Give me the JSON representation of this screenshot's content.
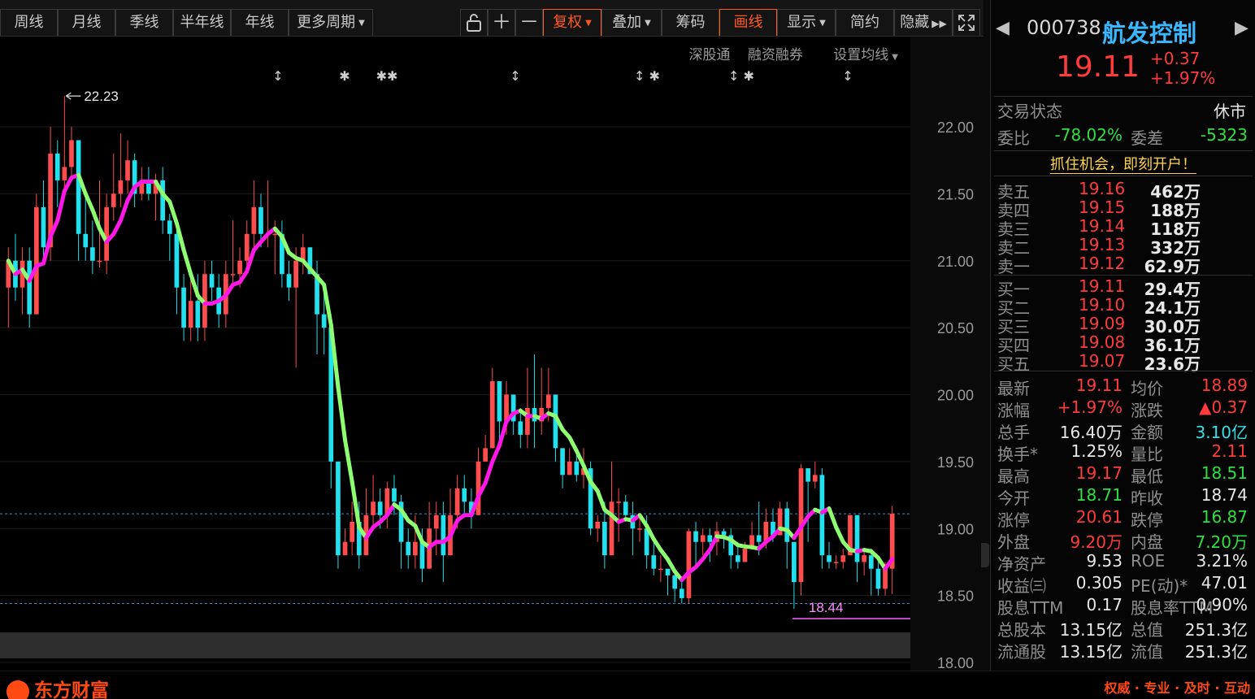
{
  "toolbar": {
    "periods": [
      "周线",
      "月线",
      "季线",
      "半年线",
      "年线"
    ],
    "more_periods": "更多周期",
    "fuquan": "复权",
    "diejia": "叠加",
    "chouma": "筹码",
    "huaxian": "画线",
    "xianshi": "显示",
    "jianyue": "简约",
    "yincang": "隐藏"
  },
  "chart_links": [
    "深股通",
    "融资融券",
    "设置均线"
  ],
  "chart_data": {
    "type": "candlestick",
    "price_axis": {
      "min": 18.0,
      "max": 22.0,
      "tick_labels": [
        "22.00",
        "21.50",
        "21.00",
        "20.50",
        "20.00",
        "19.50",
        "19.00",
        "18.50",
        "18.00"
      ]
    },
    "high_label": "22.23",
    "low_label": "18.44",
    "current_price_line": 19.11,
    "candles": [
      [
        20.8,
        21.0,
        21.1,
        20.5
      ],
      [
        21.0,
        20.8,
        21.2,
        20.7
      ],
      [
        20.8,
        21.0,
        21.1,
        20.6
      ],
      [
        21.0,
        20.6,
        21.1,
        20.5
      ],
      [
        20.6,
        21.4,
        21.5,
        20.6
      ],
      [
        21.4,
        21.1,
        21.6,
        21.0
      ],
      [
        21.1,
        21.8,
        22.0,
        21.0
      ],
      [
        21.8,
        21.6,
        21.9,
        21.4
      ],
      [
        21.6,
        21.7,
        22.23,
        21.5
      ],
      [
        21.7,
        21.9,
        22.0,
        21.6
      ],
      [
        21.9,
        21.2,
        21.9,
        21.0
      ],
      [
        21.2,
        21.1,
        21.5,
        21.0
      ],
      [
        21.1,
        21.0,
        21.3,
        20.9
      ],
      [
        21.0,
        21.0,
        21.6,
        20.95
      ],
      [
        21.0,
        21.4,
        21.5,
        20.9
      ],
      [
        21.4,
        21.5,
        21.8,
        21.3
      ],
      [
        21.5,
        21.6,
        21.95,
        21.4
      ],
      [
        21.6,
        21.75,
        21.9,
        21.5
      ],
      [
        21.75,
        21.5,
        21.8,
        21.4
      ],
      [
        21.5,
        21.6,
        21.7,
        21.45
      ],
      [
        21.6,
        21.5,
        21.7,
        21.45
      ],
      [
        21.5,
        21.6,
        21.65,
        21.3
      ],
      [
        21.6,
        21.3,
        21.7,
        21.2
      ],
      [
        21.3,
        21.2,
        21.35,
        21.0
      ],
      [
        21.2,
        20.8,
        21.3,
        20.6
      ],
      [
        20.8,
        20.5,
        20.9,
        20.4
      ],
      [
        20.5,
        20.7,
        20.9,
        20.4
      ],
      [
        20.7,
        20.5,
        20.9,
        20.4
      ],
      [
        20.5,
        20.9,
        21.0,
        20.4
      ],
      [
        20.9,
        20.8,
        21.0,
        20.7
      ],
      [
        20.8,
        20.6,
        20.9,
        20.5
      ],
      [
        20.6,
        20.9,
        21.0,
        20.5
      ],
      [
        20.9,
        20.9,
        21.3,
        20.8
      ],
      [
        20.9,
        21.0,
        21.1,
        20.8
      ],
      [
        21.0,
        21.2,
        21.3,
        20.9
      ],
      [
        21.2,
        21.4,
        21.6,
        21.1
      ],
      [
        21.4,
        21.2,
        21.5,
        21.1
      ],
      [
        21.2,
        21.2,
        21.6,
        21.1
      ],
      [
        21.2,
        21.2,
        21.3,
        20.9
      ],
      [
        21.2,
        20.9,
        21.3,
        20.8
      ],
      [
        20.9,
        20.8,
        21.0,
        20.7
      ],
      [
        20.8,
        21.0,
        21.1,
        20.2
      ],
      [
        21.0,
        21.1,
        21.2,
        20.9
      ],
      [
        21.1,
        20.9,
        21.1,
        20.9
      ],
      [
        20.9,
        20.6,
        21.0,
        20.3
      ],
      [
        20.6,
        20.5,
        20.8,
        20.3
      ],
      [
        20.5,
        19.5,
        20.6,
        19.3
      ],
      [
        19.5,
        18.8,
        19.5,
        18.7
      ],
      [
        18.8,
        18.9,
        19.0,
        18.8
      ],
      [
        18.9,
        19.05,
        19.2,
        18.8
      ],
      [
        19.05,
        18.8,
        19.2,
        18.7
      ],
      [
        18.8,
        19.1,
        19.3,
        18.8
      ],
      [
        19.1,
        19.2,
        19.4,
        19.0
      ],
      [
        19.2,
        19.1,
        19.3,
        19.0
      ],
      [
        19.1,
        19.3,
        19.35,
        19.0
      ],
      [
        19.3,
        19.2,
        19.4,
        19.1
      ],
      [
        19.2,
        18.9,
        19.25,
        18.7
      ],
      [
        18.9,
        18.8,
        19.0,
        18.7
      ],
      [
        18.8,
        18.9,
        19.1,
        18.7
      ],
      [
        18.9,
        18.7,
        19.0,
        18.6
      ],
      [
        18.7,
        19.0,
        19.2,
        18.7
      ],
      [
        19.0,
        19.1,
        19.2,
        18.8
      ],
      [
        19.1,
        18.8,
        19.2,
        18.6
      ],
      [
        18.8,
        19.1,
        19.3,
        18.8
      ],
      [
        19.1,
        19.3,
        19.4,
        19.0
      ],
      [
        19.3,
        19.2,
        19.4,
        19.1
      ],
      [
        19.2,
        19.1,
        19.3,
        19.0
      ],
      [
        19.1,
        19.5,
        19.6,
        19.1
      ],
      [
        19.5,
        19.6,
        19.7,
        19.5
      ],
      [
        19.6,
        20.1,
        20.2,
        19.6
      ],
      [
        20.1,
        19.8,
        20.1,
        19.6
      ],
      [
        19.8,
        20.0,
        20.1,
        19.7
      ],
      [
        20.0,
        19.8,
        20.0,
        19.7
      ],
      [
        19.8,
        19.7,
        19.9,
        19.6
      ],
      [
        19.7,
        19.9,
        20.2,
        19.6
      ],
      [
        19.9,
        19.8,
        20.3,
        19.6
      ],
      [
        19.8,
        19.9,
        20.2,
        19.7
      ],
      [
        19.9,
        20.0,
        20.2,
        19.8
      ],
      [
        20.0,
        19.6,
        20.0,
        19.5
      ],
      [
        19.6,
        19.4,
        19.6,
        19.3
      ],
      [
        19.4,
        19.5,
        19.6,
        19.4
      ],
      [
        19.5,
        19.4,
        19.55,
        19.35
      ],
      [
        19.4,
        19.45,
        19.6,
        19.3
      ],
      [
        19.45,
        19.0,
        19.5,
        18.95
      ],
      [
        19.0,
        19.05,
        19.1,
        18.9
      ],
      [
        19.05,
        18.8,
        19.2,
        18.7
      ],
      [
        18.8,
        19.2,
        19.5,
        18.8
      ],
      [
        19.2,
        19.2,
        19.3,
        18.9
      ],
      [
        19.2,
        19.1,
        19.25,
        19.05
      ],
      [
        19.1,
        19.0,
        19.2,
        18.8
      ],
      [
        19.0,
        19.0,
        19.1,
        18.9
      ],
      [
        19.0,
        18.8,
        19.1,
        18.7
      ],
      [
        18.8,
        18.7,
        18.9,
        18.65
      ],
      [
        18.7,
        18.7,
        18.8,
        18.6
      ],
      [
        18.7,
        18.65,
        18.7,
        18.5
      ],
      [
        18.65,
        18.55,
        18.7,
        18.45
      ],
      [
        18.55,
        18.48,
        18.6,
        18.44
      ],
      [
        18.48,
        18.98,
        19.0,
        18.44
      ],
      [
        18.98,
        18.9,
        19.05,
        18.7
      ],
      [
        18.9,
        18.95,
        19.0,
        18.8
      ],
      [
        18.95,
        18.9,
        19.0,
        18.75
      ],
      [
        18.9,
        18.98,
        19.05,
        18.8
      ],
      [
        18.98,
        18.95,
        19.0,
        18.85
      ],
      [
        18.95,
        18.8,
        19.0,
        18.7
      ],
      [
        18.8,
        18.75,
        18.9,
        18.7
      ],
      [
        18.75,
        18.85,
        18.9,
        18.75
      ],
      [
        18.85,
        18.95,
        19.05,
        18.85
      ],
      [
        18.95,
        18.9,
        19.2,
        18.8
      ],
      [
        18.9,
        19.05,
        19.15,
        18.85
      ],
      [
        19.05,
        18.95,
        19.15,
        18.9
      ],
      [
        18.95,
        19.15,
        19.2,
        18.95
      ],
      [
        19.15,
        18.9,
        19.2,
        18.7
      ],
      [
        18.9,
        18.6,
        18.9,
        18.4
      ],
      [
        18.6,
        19.45,
        19.48,
        18.5
      ],
      [
        19.45,
        19.35,
        19.45,
        18.9
      ],
      [
        19.35,
        19.4,
        19.5,
        19.3
      ],
      [
        19.4,
        18.8,
        19.45,
        18.7
      ],
      [
        18.8,
        18.75,
        18.9,
        18.7
      ],
      [
        18.75,
        18.75,
        18.8,
        18.7
      ],
      [
        18.75,
        18.8,
        18.85,
        18.7
      ],
      [
        18.8,
        19.1,
        19.1,
        18.8
      ],
      [
        19.1,
        18.75,
        19.1,
        18.6
      ],
      [
        18.75,
        18.8,
        18.85,
        18.65
      ],
      [
        18.8,
        18.7,
        18.85,
        18.5
      ],
      [
        18.7,
        18.55,
        18.75,
        18.5
      ],
      [
        18.55,
        18.7,
        18.75,
        18.5
      ],
      [
        18.7,
        19.11,
        19.17,
        18.51
      ]
    ],
    "ma_color_rising": "#ff18e6",
    "ma_color_falling": "#8dff70",
    "up_color": "#ff4d4d",
    "down_color": "#22e0ee",
    "marks": [
      "↕",
      "✱",
      "✱✱",
      "↕",
      "↕ ✱",
      "↕ ✱",
      "↕"
    ]
  },
  "panel": {
    "code": "000738",
    "name": "航发控制",
    "price": "19.11",
    "change": "+0.37",
    "change_pct": "+1.97%",
    "status_label": "交易状态",
    "status_value": "休市",
    "weibi_label": "委比",
    "weibi_value": "-78.02%",
    "weicha_label": "委差",
    "weicha_value": "-5323",
    "promo": "抓住机会，即刻开户！",
    "asks": [
      {
        "label": "卖五",
        "price": "19.16",
        "vol": "462万"
      },
      {
        "label": "卖四",
        "price": "19.15",
        "vol": "188万"
      },
      {
        "label": "卖三",
        "price": "19.14",
        "vol": "118万"
      },
      {
        "label": "卖二",
        "price": "19.13",
        "vol": "332万"
      },
      {
        "label": "卖一",
        "price": "19.12",
        "vol": "62.9万"
      }
    ],
    "bids": [
      {
        "label": "买一",
        "price": "19.11",
        "vol": "29.4万"
      },
      {
        "label": "买二",
        "price": "19.10",
        "vol": "24.1万"
      },
      {
        "label": "买三",
        "price": "19.09",
        "vol": "30.0万"
      },
      {
        "label": "买四",
        "price": "19.08",
        "vol": "36.1万"
      },
      {
        "label": "买五",
        "price": "19.07",
        "vol": "23.6万"
      }
    ],
    "stats": [
      {
        "l1": "最新",
        "v1": "19.11",
        "c1": "red",
        "l2": "均价",
        "v2": "18.89",
        "c2": "red"
      },
      {
        "l1": "涨幅",
        "v1": "+1.97%",
        "c1": "red",
        "l2": "涨跌",
        "v2": "▲0.37",
        "c2": "red"
      },
      {
        "l1": "总手",
        "v1": "16.40万",
        "c1": "white",
        "l2": "金额",
        "v2": "3.10亿",
        "c2": "cyan"
      },
      {
        "l1": "换手*",
        "v1": "1.25%",
        "c1": "white",
        "l2": "量比",
        "v2": "2.11",
        "c2": "red"
      },
      {
        "l1": "最高",
        "v1": "19.17",
        "c1": "red",
        "l2": "最低",
        "v2": "18.51",
        "c2": "green"
      },
      {
        "l1": "今开",
        "v1": "18.71",
        "c1": "green",
        "l2": "昨收",
        "v2": "18.74",
        "c2": "white"
      },
      {
        "l1": "涨停",
        "v1": "20.61",
        "c1": "red",
        "l2": "跌停",
        "v2": "16.87",
        "c2": "green"
      },
      {
        "l1": "外盘",
        "v1": "9.20万",
        "c1": "red",
        "l2": "内盘",
        "v2": "7.20万",
        "c2": "green"
      },
      {
        "l1": "净资产",
        "v1": "9.53",
        "c1": "white",
        "l2": "ROE",
        "v2": "3.21%",
        "c2": "white"
      },
      {
        "l1": "收益㈢",
        "v1": "0.305",
        "c1": "white",
        "l2": "PE(动)*",
        "v2": "47.01",
        "c2": "white"
      },
      {
        "l1": "股息TTM",
        "v1": "0.17",
        "c1": "white",
        "l2": "股息率TTM",
        "v2": "0.90%",
        "c2": "white"
      },
      {
        "l1": "总股本",
        "v1": "13.15亿",
        "c1": "white",
        "l2": "总值",
        "v2": "251.3亿",
        "c2": "white"
      },
      {
        "l1": "流通股",
        "v1": "13.15亿",
        "c1": "white",
        "l2": "流值",
        "v2": "251.3亿",
        "c2": "white"
      }
    ]
  },
  "footer": {
    "logo": "东方财富",
    "slogan": "权威 · 专业 · 及时 · 互动"
  }
}
